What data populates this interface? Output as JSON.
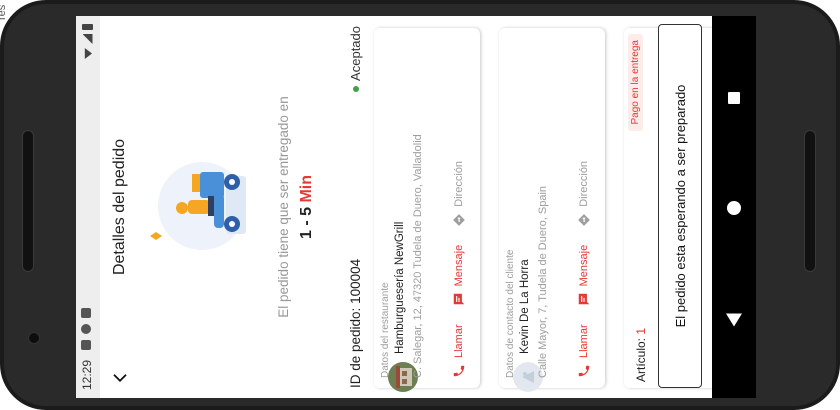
{
  "corner_text": "res",
  "status_bar": {
    "time": "12:29"
  },
  "header": {
    "title": "Detalles del pedido"
  },
  "delivery": {
    "subtitle": "El pedido tiene que ser entregado en",
    "time_range": "1 - 5",
    "time_unit": "Min"
  },
  "order": {
    "id_label": "ID de pedido:",
    "id_value": "100004",
    "status": "Aceptado"
  },
  "restaurant": {
    "section_label": "Datos del restaurante",
    "name": "Hamburguesería NewGrill",
    "address": "C. Salegar, 12, 47320 Tudela de Duero, Valladolid",
    "actions": {
      "call": "Llamar",
      "message": "Mensaje",
      "direction": "Dirección"
    }
  },
  "client": {
    "section_label": "Datos de contacto del cliente",
    "name": "Kevin De La Horra",
    "address": "Calle Mayor, 7, Tudela de Duero, Spain",
    "actions": {
      "call": "Llamar",
      "message": "Mensaje",
      "direction": "Dirección"
    }
  },
  "payment": {
    "articles_label": "Artículo:",
    "articles_count": "1",
    "badge": "Pago en la entrega"
  },
  "banner": {
    "text": "El pedido esta esperando a ser preparado"
  },
  "colors": {
    "accent": "#e53935",
    "status_green": "#43a047",
    "illustration_blue": "#4a90d9",
    "illustration_orange": "#f5a623"
  }
}
